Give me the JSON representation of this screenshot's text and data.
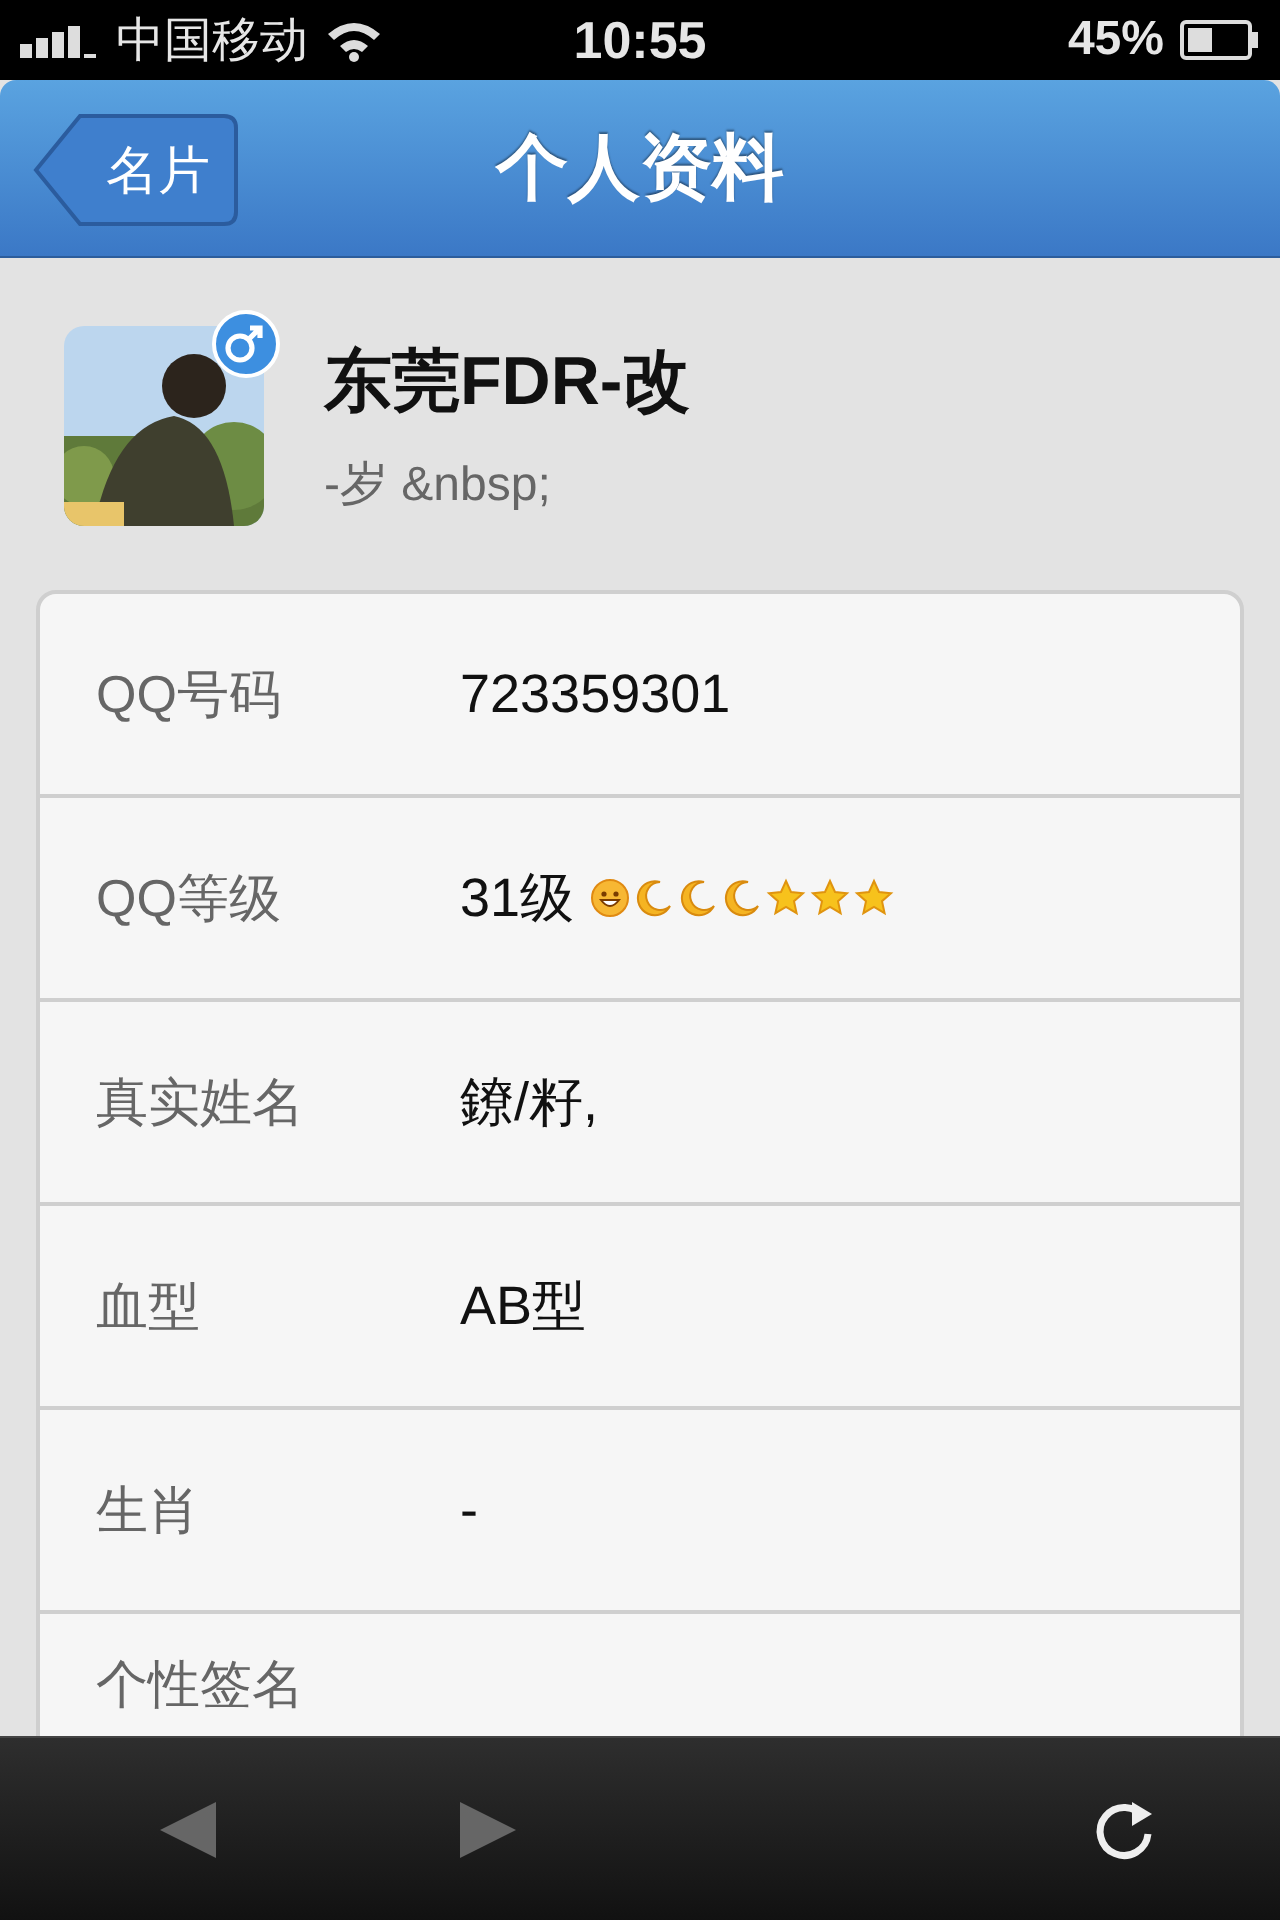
{
  "status_bar": {
    "carrier": "中国移动",
    "time": "10:55",
    "battery": "45%"
  },
  "nav_bar": {
    "back": "名片",
    "title": "个人资料"
  },
  "profile": {
    "gender_badge": {
      "kind": "male"
    },
    "name": "东莞FDR-改",
    "subtitle": "-岁 &nbsp;"
  },
  "fields": [
    {
      "label": "QQ号码",
      "value": "723359301"
    },
    {
      "label": "QQ等级",
      "value": "31级",
      "level_icons": [
        {
          "kind": "sun"
        },
        {
          "kind": "moon"
        },
        {
          "kind": "moon"
        },
        {
          "kind": "moon"
        },
        {
          "kind": "star"
        },
        {
          "kind": "star"
        },
        {
          "kind": "star"
        }
      ]
    },
    {
      "label": "真实姓名",
      "value": "鐐/籽,"
    },
    {
      "label": "血型",
      "value": "AB型"
    },
    {
      "label": "生肖",
      "value": "-"
    },
    {
      "label": "个性签名"
    }
  ]
}
